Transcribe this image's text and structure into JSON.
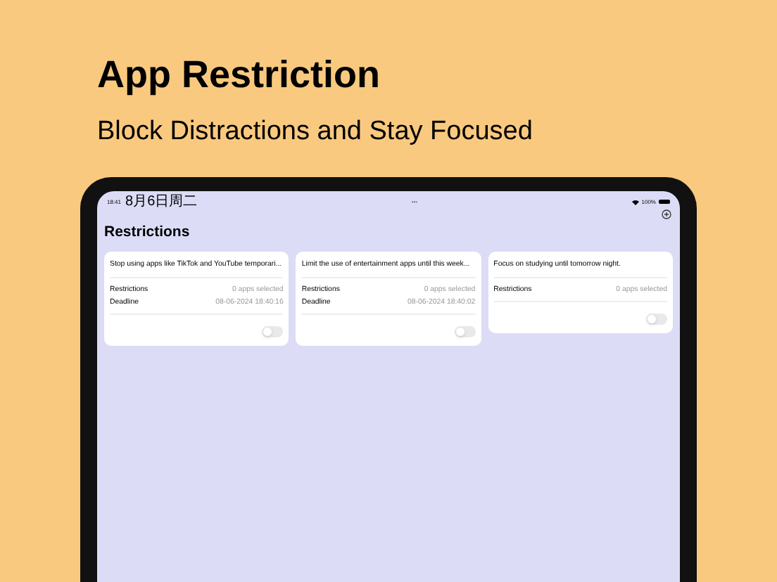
{
  "headline": "App Restriction",
  "subheadline": "Block Distractions and Stay Focused",
  "status_bar": {
    "time": "18:41",
    "date": "8月6日周二",
    "dots": "•••",
    "battery": "100%"
  },
  "screen_title": "Restrictions",
  "cards": [
    {
      "title": "Stop using apps like TikTok and YouTube temporari...",
      "rows": [
        {
          "label": "Restrictions",
          "value": "0 apps selected"
        },
        {
          "label": "Deadline",
          "value": "08-06-2024 18:40:16"
        }
      ],
      "on": false
    },
    {
      "title": "Limit the use of entertainment apps until this week...",
      "rows": [
        {
          "label": "Restrictions",
          "value": "0 apps selected"
        },
        {
          "label": "Deadline",
          "value": "08-06-2024 18:40:02"
        }
      ],
      "on": false
    },
    {
      "title": "Focus on studying until tomorrow night.",
      "rows": [
        {
          "label": "Restrictions",
          "value": "0 apps selected"
        }
      ],
      "on": false
    }
  ]
}
